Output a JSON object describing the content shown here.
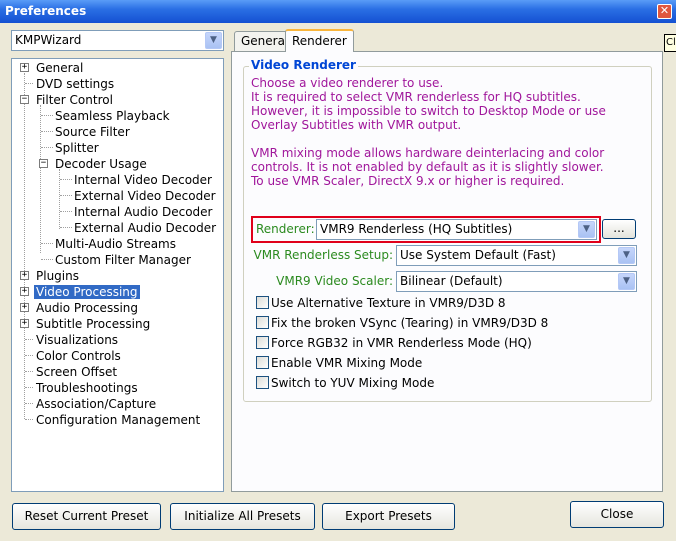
{
  "window": {
    "title": "Preferences",
    "side_tip": "Cl"
  },
  "preset": {
    "value": "KMPWizard"
  },
  "tree": {
    "items": [
      {
        "label": "General"
      },
      {
        "label": "DVD settings"
      },
      {
        "label": "Filter Control"
      },
      {
        "label": "Seamless Playback"
      },
      {
        "label": "Source Filter"
      },
      {
        "label": "Splitter"
      },
      {
        "label": "Decoder Usage"
      },
      {
        "label": "Internal Video Decoder"
      },
      {
        "label": "External Video Decoder"
      },
      {
        "label": "Internal Audio Decoder"
      },
      {
        "label": "External Audio Decoder"
      },
      {
        "label": "Multi-Audio Streams"
      },
      {
        "label": "Custom Filter Manager"
      },
      {
        "label": "Plugins"
      },
      {
        "label": "Video Processing"
      },
      {
        "label": "Audio Processing"
      },
      {
        "label": "Subtitle Processing"
      },
      {
        "label": "Visualizations"
      },
      {
        "label": "Color Controls"
      },
      {
        "label": "Screen Offset"
      },
      {
        "label": "Troubleshootings"
      },
      {
        "label": "Association/Capture"
      },
      {
        "label": "Configuration Management"
      }
    ],
    "selected": "Video Processing"
  },
  "tabs": [
    {
      "label": "General"
    },
    {
      "label": "Renderer"
    }
  ],
  "renderer_panel": {
    "group_title": "Video Renderer",
    "desc1": [
      "Choose a video renderer to use.",
      "It is required to select VMR renderless for HQ subtitles.",
      "However, it is impossible to switch to Desktop Mode or use",
      "Overlay Subtitles with VMR output."
    ],
    "desc2": [
      "VMR mixing mode allows hardware deinterlacing and color",
      "controls. It is not enabled by default as it is slightly slower.",
      "To use VMR Scaler, DirectX 9.x or higher is required."
    ],
    "renderer_label": "Renderer:",
    "renderer_value": "VMR9 Renderless (HQ Subtitles)",
    "renderer_more": "...",
    "setup_label": "VMR Renderless Setup:",
    "setup_value": "Use System Default (Fast)",
    "scaler_label": "VMR9 Video Scaler:",
    "scaler_value": "Bilinear (Default)",
    "checkboxes": [
      {
        "label": "Use Alternative Texture in VMR9/D3D 8",
        "checked": false
      },
      {
        "label": "Fix the broken VSync (Tearing) in VMR9/D3D 8",
        "checked": false
      },
      {
        "label": "Force RGB32 in VMR Renderless Mode (HQ)",
        "checked": false
      },
      {
        "label": "Enable VMR Mixing Mode",
        "checked": false
      },
      {
        "label": "Switch to YUV Mixing Mode",
        "checked": false
      }
    ]
  },
  "buttons": {
    "reset": "Reset Current Preset",
    "initialize": "Initialize All Presets",
    "export": "Export Presets",
    "close": "Close"
  }
}
